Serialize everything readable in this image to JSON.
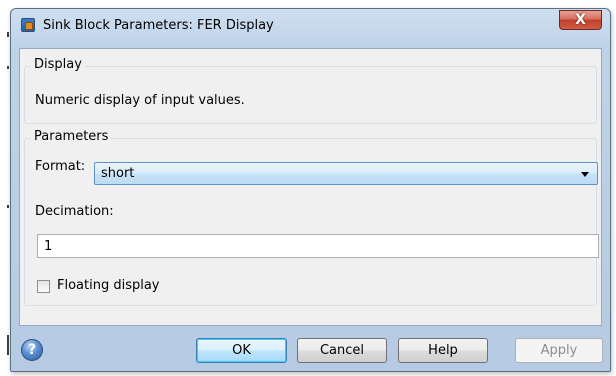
{
  "window": {
    "title": "Sink Block Parameters: FER Display",
    "close_label": "X"
  },
  "display_group": {
    "legend": "Display",
    "description": "Numeric display of input values."
  },
  "parameters_group": {
    "legend": "Parameters",
    "format_label": "Format:",
    "format_value": "short",
    "decimation_label": "Decimation:",
    "decimation_value": "1",
    "floating_display_label": "Floating display",
    "floating_display_checked": false
  },
  "buttons": {
    "ok": "OK",
    "cancel": "Cancel",
    "help": "Help",
    "apply": "Apply",
    "help_icon": "?"
  },
  "icons": {
    "title_icon": "simulink-block-icon",
    "help_icon": "help-icon",
    "dropdown_arrow": "chevron-down-icon"
  },
  "colors": {
    "title_bar": "#bed2e8",
    "close_button": "#c2402b",
    "selected_field": "#c6e2f7",
    "default_button_border": "#3c7fb1"
  }
}
